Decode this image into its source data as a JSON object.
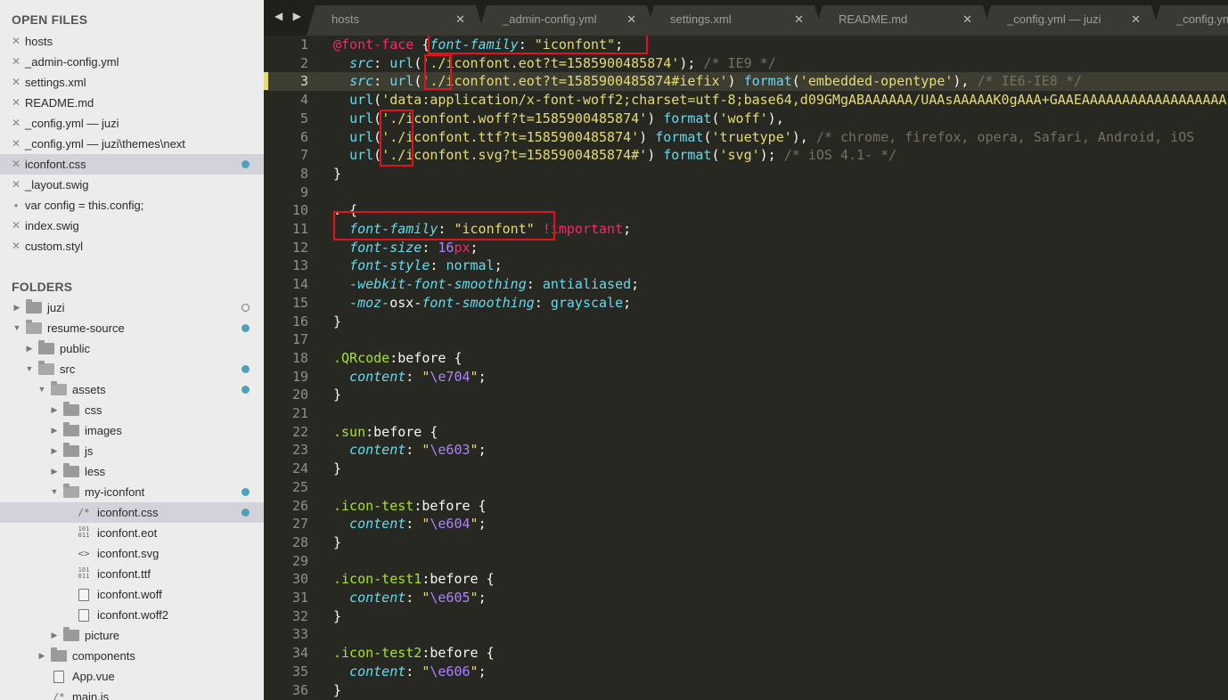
{
  "sidebar": {
    "open_files_heading": "OPEN FILES",
    "folders_heading": "FOLDERS",
    "open_files": [
      {
        "label": "hosts"
      },
      {
        "label": "_admin-config.yml"
      },
      {
        "label": "settings.xml"
      },
      {
        "label": "README.md"
      },
      {
        "label": "_config.yml — juzi"
      },
      {
        "label": "_config.yml — juzi\\themes\\next"
      },
      {
        "label": "iconfont.css",
        "selected": true,
        "dirty": true
      },
      {
        "label": "_layout.swig"
      },
      {
        "label": "var config = this.config;",
        "unsaved_dot": true
      },
      {
        "label": "index.swig"
      },
      {
        "label": "custom.styl"
      }
    ],
    "tree": [
      {
        "label": "juzi",
        "type": "folder",
        "depth": 0,
        "expanded": false,
        "badge": "ring"
      },
      {
        "label": "resume-source",
        "type": "folder",
        "depth": 0,
        "expanded": true,
        "badge": "dot"
      },
      {
        "label": "public",
        "type": "folder",
        "depth": 1,
        "expanded": false
      },
      {
        "label": "src",
        "type": "folder",
        "depth": 1,
        "expanded": true,
        "badge": "dot"
      },
      {
        "label": "assets",
        "type": "folder",
        "depth": 2,
        "expanded": true,
        "badge": "dot"
      },
      {
        "label": "css",
        "type": "folder",
        "depth": 3,
        "expanded": false
      },
      {
        "label": "images",
        "type": "folder",
        "depth": 3,
        "expanded": false
      },
      {
        "label": "js",
        "type": "folder",
        "depth": 3,
        "expanded": false
      },
      {
        "label": "less",
        "type": "folder",
        "depth": 3,
        "expanded": false
      },
      {
        "label": "my-iconfont",
        "type": "folder",
        "depth": 3,
        "expanded": true,
        "badge": "dot"
      },
      {
        "label": "iconfont.css",
        "type": "file",
        "glyph": "/*",
        "depth": 4,
        "selected": true,
        "badge": "dot"
      },
      {
        "label": "iconfont.eot",
        "type": "file",
        "glyph": "bin",
        "depth": 4
      },
      {
        "label": "iconfont.svg",
        "type": "file",
        "glyph": "<>",
        "depth": 4
      },
      {
        "label": "iconfont.ttf",
        "type": "file",
        "glyph": "bin",
        "depth": 4
      },
      {
        "label": "iconfont.woff",
        "type": "file",
        "glyph": "doc",
        "depth": 4
      },
      {
        "label": "iconfont.woff2",
        "type": "file",
        "glyph": "doc",
        "depth": 4
      },
      {
        "label": "picture",
        "type": "folder",
        "depth": 3,
        "expanded": false
      },
      {
        "label": "components",
        "type": "folder",
        "depth": 2,
        "expanded": false
      },
      {
        "label": "App.vue",
        "type": "file",
        "glyph": "doc",
        "depth": 2
      },
      {
        "label": "main.js",
        "type": "file",
        "glyph": "/*",
        "depth": 2
      }
    ],
    "binary_glyph": [
      "101",
      "011"
    ]
  },
  "tabbar": {
    "nav": "◀ ▶",
    "tabs": [
      {
        "label": "hosts"
      },
      {
        "label": "_admin-config.yml"
      },
      {
        "label": "settings.xml"
      },
      {
        "label": "README.md"
      },
      {
        "label": "_config.yml — juzi"
      },
      {
        "label": "_config.yml"
      }
    ],
    "close_glyph": "✕"
  },
  "editor": {
    "active_line": 3,
    "lines": [
      [
        [
          "k",
          "@font-face"
        ],
        [
          "w",
          " {"
        ],
        [
          "p",
          "font-family"
        ],
        [
          "w",
          ": "
        ],
        [
          "s",
          "\"iconfont\""
        ],
        [
          "w",
          ";"
        ]
      ],
      [
        [
          "w",
          "  "
        ],
        [
          "p",
          "src"
        ],
        [
          "w",
          ": "
        ],
        [
          "f",
          "url"
        ],
        [
          "w",
          "("
        ],
        [
          "s",
          "'./iconfont.eot?t=1585900485874'"
        ],
        [
          "w",
          "); "
        ],
        [
          "c",
          "/* IE9 */"
        ]
      ],
      [
        [
          "w",
          "  "
        ],
        [
          "p",
          "src"
        ],
        [
          "w",
          ": "
        ],
        [
          "f",
          "url"
        ],
        [
          "w",
          "("
        ],
        [
          "s",
          "'./iconfont.eot?t=1585900485874#iefix'"
        ],
        [
          "w",
          ") "
        ],
        [
          "f",
          "format"
        ],
        [
          "w",
          "("
        ],
        [
          "s",
          "'embedded-opentype'"
        ],
        [
          "w",
          "), "
        ],
        [
          "c",
          "/* IE6-IE8 */"
        ]
      ],
      [
        [
          "w",
          "  "
        ],
        [
          "f",
          "url"
        ],
        [
          "w",
          "("
        ],
        [
          "s",
          "'data:application/x-font-woff2;charset=utf-8;base64,d09GMgABAAAAAA/UAAsAAAAAK0gAAA+GAAEAAAAAAAAAAAAAAAAAA"
        ]
      ],
      [
        [
          "w",
          "  "
        ],
        [
          "f",
          "url"
        ],
        [
          "w",
          "("
        ],
        [
          "s",
          "'./iconfont.woff?t=1585900485874'"
        ],
        [
          "w",
          ") "
        ],
        [
          "f",
          "format"
        ],
        [
          "w",
          "("
        ],
        [
          "s",
          "'woff'"
        ],
        [
          "w",
          "),"
        ]
      ],
      [
        [
          "w",
          "  "
        ],
        [
          "f",
          "url"
        ],
        [
          "w",
          "("
        ],
        [
          "s",
          "'./iconfont.ttf?t=1585900485874'"
        ],
        [
          "w",
          ") "
        ],
        [
          "f",
          "format"
        ],
        [
          "w",
          "("
        ],
        [
          "s",
          "'truetype'"
        ],
        [
          "w",
          "), "
        ],
        [
          "c",
          "/* chrome, firefox, opera, Safari, Android, iOS"
        ]
      ],
      [
        [
          "w",
          "  "
        ],
        [
          "f",
          "url"
        ],
        [
          "w",
          "("
        ],
        [
          "s",
          "'./iconfont.svg?t=1585900485874#'"
        ],
        [
          "w",
          ") "
        ],
        [
          "f",
          "format"
        ],
        [
          "w",
          "("
        ],
        [
          "s",
          "'svg'"
        ],
        [
          "w",
          "); "
        ],
        [
          "c",
          "/* iOS 4.1- */"
        ]
      ],
      [
        [
          "w",
          "}"
        ]
      ],
      [],
      [
        [
          "w",
          ". {"
        ]
      ],
      [
        [
          "w",
          "  "
        ],
        [
          "p",
          "font-family"
        ],
        [
          "w",
          ": "
        ],
        [
          "s",
          "\"iconfont\""
        ],
        [
          "w",
          " "
        ],
        [
          "im",
          "!important"
        ],
        [
          "w",
          ";"
        ]
      ],
      [
        [
          "w",
          "  "
        ],
        [
          "p",
          "font-size"
        ],
        [
          "w",
          ": "
        ],
        [
          "n",
          "16"
        ],
        [
          "u",
          "px"
        ],
        [
          "w",
          ";"
        ]
      ],
      [
        [
          "w",
          "  "
        ],
        [
          "p",
          "font-style"
        ],
        [
          "w",
          ": "
        ],
        [
          "v",
          "normal"
        ],
        [
          "w",
          ";"
        ]
      ],
      [
        [
          "w",
          "  "
        ],
        [
          "p",
          "-webkit-font-smoothing"
        ],
        [
          "w",
          ": "
        ],
        [
          "v",
          "antialiased"
        ],
        [
          "w",
          ";"
        ]
      ],
      [
        [
          "w",
          "  "
        ],
        [
          "p",
          "-moz-"
        ],
        [
          "w",
          "osx-"
        ],
        [
          "p",
          "font-smoothing"
        ],
        [
          "w",
          ": "
        ],
        [
          "v",
          "grayscale"
        ],
        [
          "w",
          ";"
        ]
      ],
      [
        [
          "w",
          "}"
        ]
      ],
      [],
      [
        [
          "sel",
          ".QRcode"
        ],
        [
          "w",
          ":before {"
        ]
      ],
      [
        [
          "w",
          "  "
        ],
        [
          "p",
          "content"
        ],
        [
          "w",
          ": "
        ],
        [
          "s",
          "\""
        ],
        [
          "e",
          "\\e704"
        ],
        [
          "s",
          "\""
        ],
        [
          "w",
          ";"
        ]
      ],
      [
        [
          "w",
          "}"
        ]
      ],
      [],
      [
        [
          "sel",
          ".sun"
        ],
        [
          "w",
          ":before {"
        ]
      ],
      [
        [
          "w",
          "  "
        ],
        [
          "p",
          "content"
        ],
        [
          "w",
          ": "
        ],
        [
          "s",
          "\""
        ],
        [
          "e",
          "\\e603"
        ],
        [
          "s",
          "\""
        ],
        [
          "w",
          ";"
        ]
      ],
      [
        [
          "w",
          "}"
        ]
      ],
      [],
      [
        [
          "sel",
          ".icon-test"
        ],
        [
          "w",
          ":before {"
        ]
      ],
      [
        [
          "w",
          "  "
        ],
        [
          "p",
          "content"
        ],
        [
          "w",
          ": "
        ],
        [
          "s",
          "\""
        ],
        [
          "e",
          "\\e604"
        ],
        [
          "s",
          "\""
        ],
        [
          "w",
          ";"
        ]
      ],
      [
        [
          "w",
          "}"
        ]
      ],
      [],
      [
        [
          "sel",
          ".icon-test1"
        ],
        [
          "w",
          ":before {"
        ]
      ],
      [
        [
          "w",
          "  "
        ],
        [
          "p",
          "content"
        ],
        [
          "w",
          ": "
        ],
        [
          "s",
          "\""
        ],
        [
          "e",
          "\\e605"
        ],
        [
          "s",
          "\""
        ],
        [
          "w",
          ";"
        ]
      ],
      [
        [
          "w",
          "}"
        ]
      ],
      [],
      [
        [
          "sel",
          ".icon-test2"
        ],
        [
          "w",
          ":before {"
        ]
      ],
      [
        [
          "w",
          "  "
        ],
        [
          "p",
          "content"
        ],
        [
          "w",
          ": "
        ],
        [
          "s",
          "\""
        ],
        [
          "e",
          "\\e606"
        ],
        [
          "s",
          "\""
        ],
        [
          "w",
          ";"
        ]
      ],
      [
        [
          "w",
          "}"
        ]
      ]
    ]
  },
  "colors": {
    "sidebar_bg": "#ececec",
    "selected_row": "#d2d2da",
    "dirty_dot": "#4da1b8",
    "editor_bg": "#272822",
    "highlight_box": "#e0141e"
  },
  "icons": {
    "close": "close-icon",
    "folder": "folder-icon",
    "arrow_right": "chevron-right-icon",
    "arrow_down": "chevron-down-icon"
  }
}
